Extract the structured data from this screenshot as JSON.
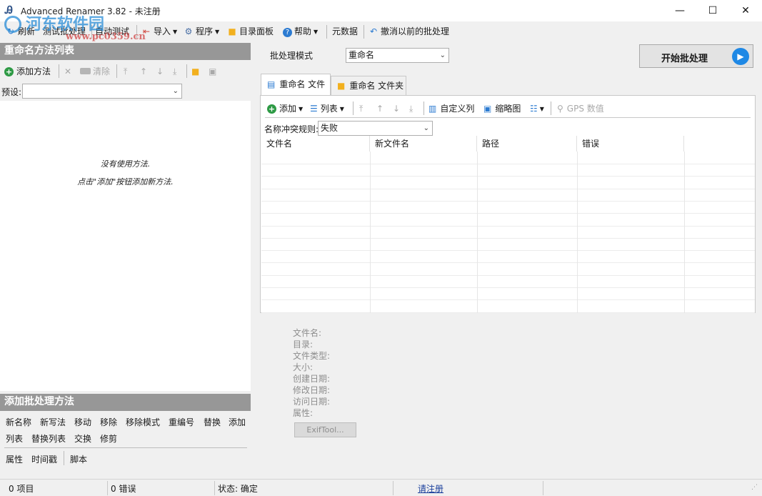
{
  "window": {
    "title": "Advanced Renamer 3.82 - 未注册",
    "minimize": "—",
    "maximize": "☐",
    "close": "✕"
  },
  "watermark": {
    "site_name": "河东软件园",
    "site_url": "www.pc0359.cn"
  },
  "toolbar": {
    "refresh": "刷新",
    "test_batch": "测试批处理",
    "auto_test": "自动测试",
    "import": "导入",
    "program": "程序",
    "dir_panel": "目录面板",
    "help": "帮助",
    "metadata": "元数据",
    "undo_batch": "撤消以前的批处理"
  },
  "methods_panel": {
    "header": "重命名方法列表",
    "add_method": "添加方法",
    "clear": "清除",
    "preset_label": "预设:",
    "preset_value": "",
    "empty_line1": "没有使用方法.",
    "empty_line2": "点击\"添加\"按钮添加新方法."
  },
  "add_panel": {
    "header": "添加批处理方法",
    "methods_row1": [
      "新名称",
      "新写法",
      "移动",
      "移除",
      "移除模式",
      "重编号",
      "替换",
      "添加"
    ],
    "methods_row2": [
      "列表",
      "替换列表",
      "交换",
      "修剪"
    ],
    "methods_row3": [
      "属性",
      "时间戳"
    ],
    "script": "脚本"
  },
  "batch": {
    "mode_label": "批处理模式",
    "mode_value": "重命名",
    "start_button": "开始批处理"
  },
  "tabs": {
    "files": "重命名 文件",
    "folders": "重命名 文件夹"
  },
  "files_toolbar": {
    "add": "添加",
    "list": "列表",
    "custom_columns": "自定义列",
    "thumbnails": "缩略图",
    "gps": "GPS 数值"
  },
  "conflict": {
    "label": "名称冲突规则:",
    "value": "失败"
  },
  "grid": {
    "columns": [
      "文件名",
      "新文件名",
      "路径",
      "错误"
    ]
  },
  "info": {
    "labels": [
      "文件名:",
      "目录:",
      "文件类型:",
      "大小:",
      "创建日期:",
      "修改日期:",
      "访问日期:",
      "属性:"
    ],
    "exif_button": "ExifTool..."
  },
  "statusbar": {
    "items": "0 项目",
    "errors": "0 错误",
    "status": "状态: 确定",
    "register": "请注册"
  },
  "colors": {
    "pane_header": "#979797",
    "accent_blue": "#1e88e5",
    "add_green": "#2e9a45",
    "folder_yellow": "#f2b01e"
  }
}
